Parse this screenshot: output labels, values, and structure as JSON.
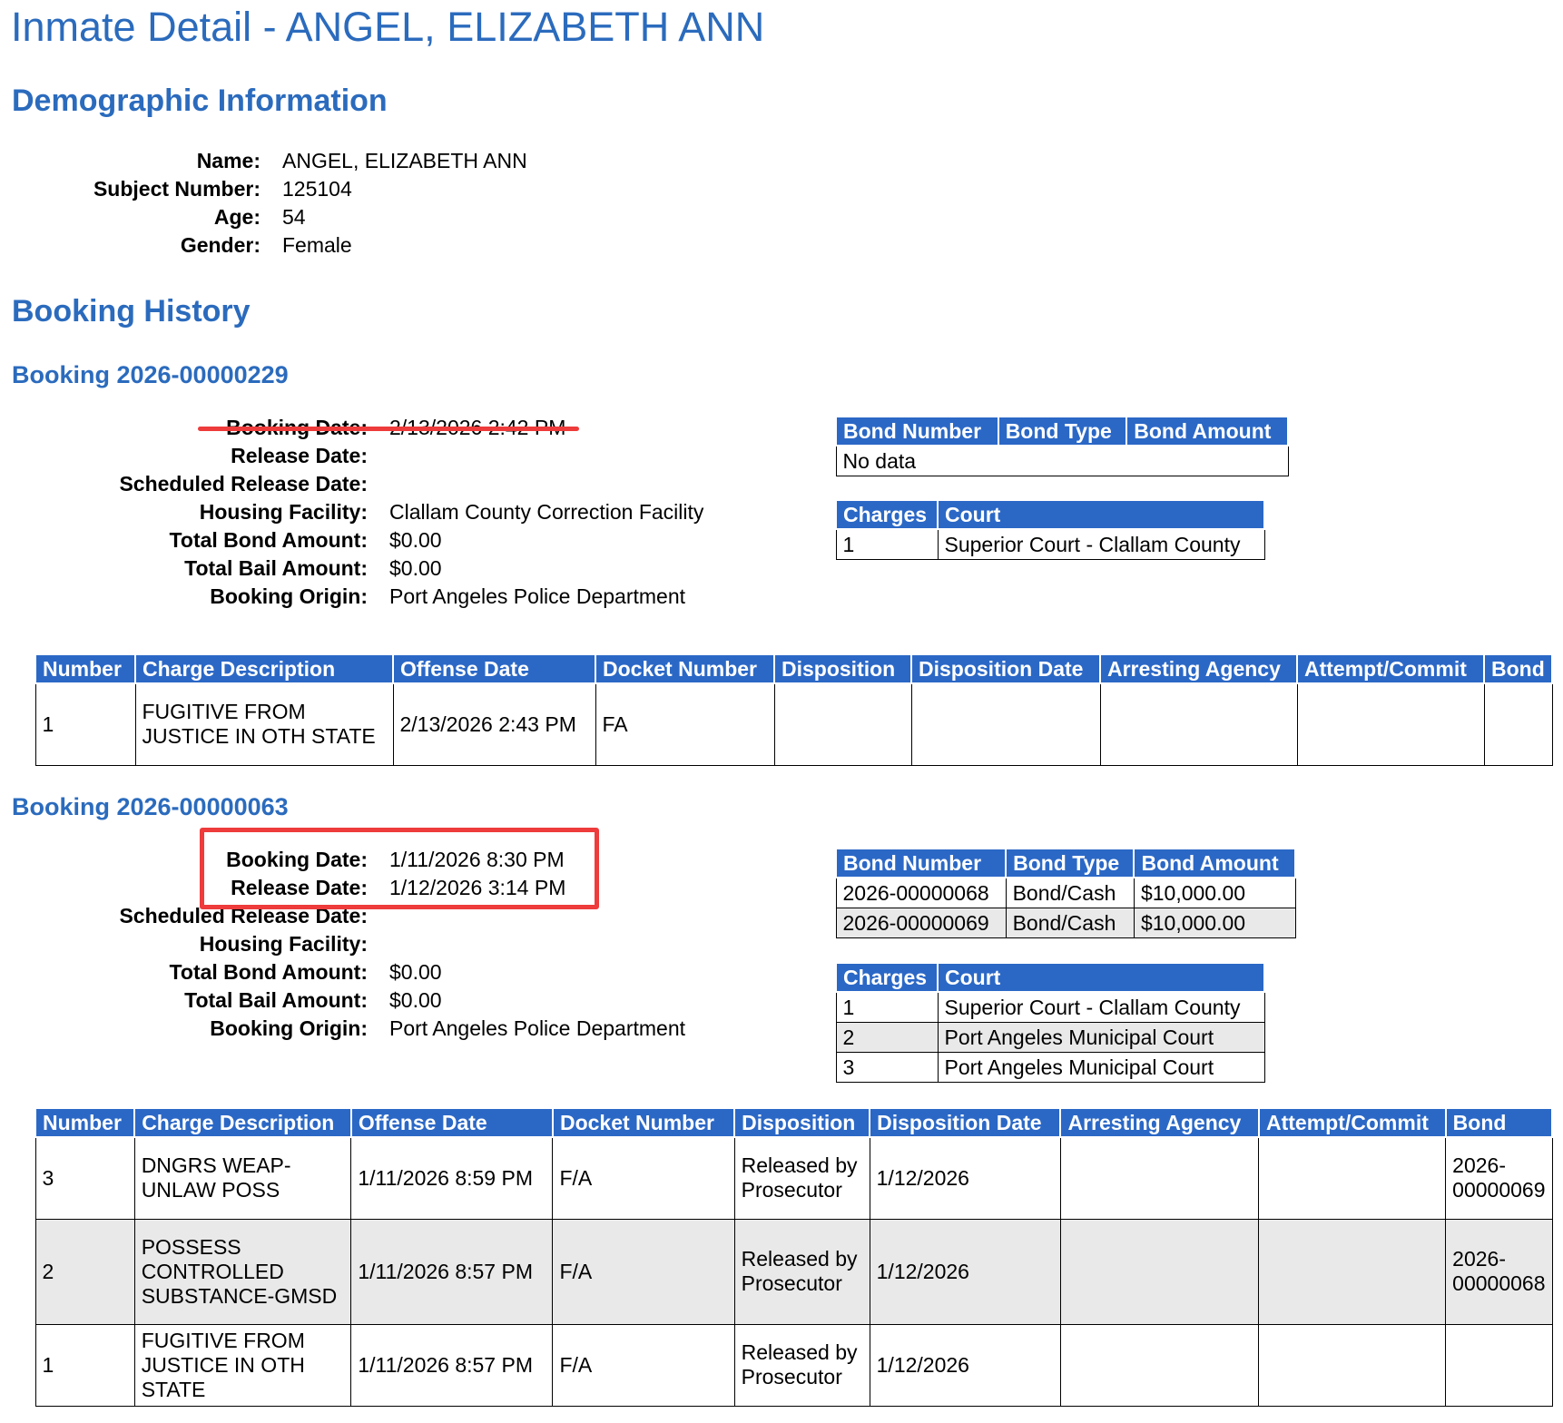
{
  "page_title": "Inmate Detail - ANGEL, ELIZABETH ANN",
  "demographics": {
    "heading": "Demographic Information",
    "fields": [
      {
        "label": "Name:",
        "value": "ANGEL, ELIZABETH ANN"
      },
      {
        "label": "Subject Number:",
        "value": "125104"
      },
      {
        "label": "Age:",
        "value": "54"
      },
      {
        "label": "Gender:",
        "value": "Female"
      }
    ]
  },
  "booking_history_heading": "Booking History",
  "bookings": [
    {
      "heading": "Booking 2026-00000229",
      "fields": [
        {
          "label": "Booking Date:",
          "value": "2/13/2026 2:42 PM"
        },
        {
          "label": "Release Date:",
          "value": ""
        },
        {
          "label": "Scheduled Release Date:",
          "value": ""
        },
        {
          "label": "Housing Facility:",
          "value": "Clallam County Correction Facility"
        },
        {
          "label": "Total Bond Amount:",
          "value": "$0.00"
        },
        {
          "label": "Total Bail Amount:",
          "value": "$0.00"
        },
        {
          "label": "Booking Origin:",
          "value": "Port Angeles Police Department"
        }
      ],
      "bond_table": {
        "headers": [
          "Bond Number",
          "Bond Type",
          "Bond Amount"
        ],
        "no_data": "No data",
        "rows": []
      },
      "court_table": {
        "headers": [
          "Charges",
          "Court"
        ],
        "rows": [
          [
            "1",
            "Superior Court - Clallam County"
          ]
        ]
      },
      "charges_table": {
        "headers": [
          "Number",
          "Charge Description",
          "Offense Date",
          "Docket Number",
          "Disposition",
          "Disposition Date",
          "Arresting Agency",
          "Attempt/Commit",
          "Bond"
        ],
        "rows": [
          [
            "1",
            "FUGITIVE FROM JUSTICE IN OTH STATE",
            "2/13/2026 2:43 PM",
            "FA",
            "",
            "",
            "",
            "",
            ""
          ]
        ]
      }
    },
    {
      "heading": "Booking 2026-00000063",
      "fields": [
        {
          "label": "Booking Date:",
          "value": "1/11/2026 8:30 PM"
        },
        {
          "label": "Release Date:",
          "value": "1/12/2026 3:14 PM"
        },
        {
          "label": "Scheduled Release Date:",
          "value": ""
        },
        {
          "label": "Housing Facility:",
          "value": ""
        },
        {
          "label": "Total Bond Amount:",
          "value": "$0.00"
        },
        {
          "label": "Total Bail Amount:",
          "value": "$0.00"
        },
        {
          "label": "Booking Origin:",
          "value": "Port Angeles Police Department"
        }
      ],
      "bond_table": {
        "headers": [
          "Bond Number",
          "Bond Type",
          "Bond Amount"
        ],
        "rows": [
          [
            "2026-00000068",
            "Bond/Cash",
            "$10,000.00"
          ],
          [
            "2026-00000069",
            "Bond/Cash",
            "$10,000.00"
          ]
        ]
      },
      "court_table": {
        "headers": [
          "Charges",
          "Court"
        ],
        "rows": [
          [
            "1",
            "Superior Court - Clallam County"
          ],
          [
            "2",
            "Port Angeles Municipal Court"
          ],
          [
            "3",
            "Port Angeles Municipal Court"
          ]
        ]
      },
      "charges_table": {
        "headers": [
          "Number",
          "Charge Description",
          "Offense Date",
          "Docket Number",
          "Disposition",
          "Disposition Date",
          "Arresting Agency",
          "Attempt/Commit",
          "Bond"
        ],
        "rows": [
          [
            "3",
            "DNGRS WEAP-UNLAW POSS",
            "1/11/2026 8:59 PM",
            "F/A",
            "Released by Prosecutor",
            "1/12/2026",
            "",
            "",
            "2026-00000069"
          ],
          [
            "2",
            "POSSESS CONTROLLED SUBSTANCE-GMSD",
            "1/11/2026 8:57 PM",
            "F/A",
            "Released by Prosecutor",
            "1/12/2026",
            "",
            "",
            "2026-00000068"
          ],
          [
            "1",
            "FUGITIVE FROM JUSTICE IN OTH STATE",
            "1/11/2026 8:57 PM",
            "F/A",
            "Released by Prosecutor",
            "1/12/2026",
            "",
            "",
            ""
          ]
        ]
      }
    }
  ],
  "colors": {
    "heading": "#2b6bbd",
    "table_header": "#2b68c6",
    "annotation": "#ee3b3b",
    "alt_row": "#e9e9e9"
  }
}
